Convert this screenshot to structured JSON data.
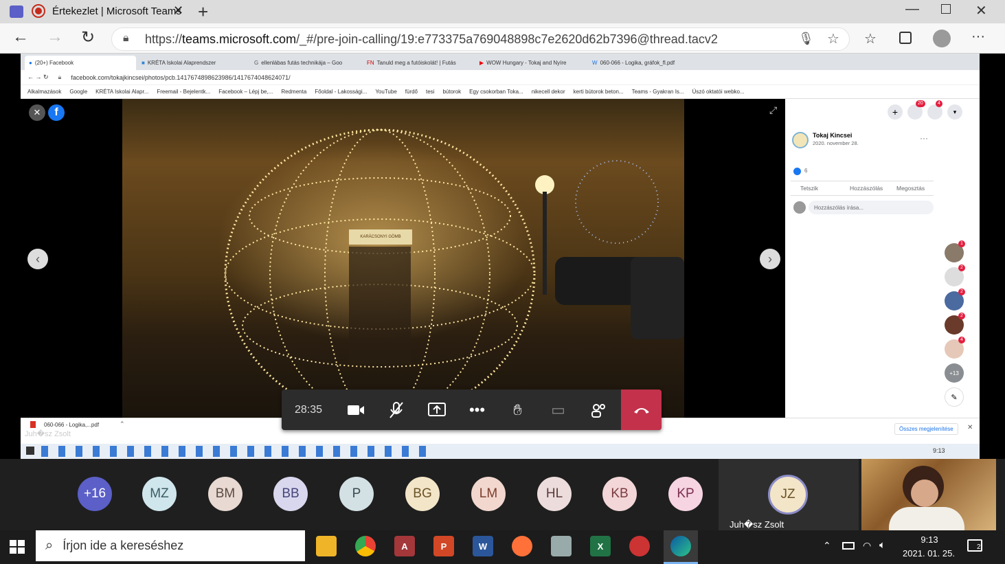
{
  "outer_tab": {
    "title": "Értekezlet | Microsoft Teams"
  },
  "outer_url": {
    "prefix": "https://",
    "host": "teams.microsoft.com",
    "path": "/_#/pre-join-calling/19:e773375a769048898c7e2620d62b7396@thread.tacv2"
  },
  "inner_tabs": [
    "(20+) Facebook",
    "KRÉTA Iskolai Alaprendszer",
    "ellenlábas futás technikája – Goo",
    "Tanuld meg a futóiskolát! | Futás",
    "WOW Hungary - Tokaj and Nyíre",
    "060-066 - Logika, gráfok_fl.pdf"
  ],
  "inner_url": "facebook.com/tokajkincsei/photos/pcb.1417674898623986/1417674048624071/",
  "bookmarks": [
    "Alkalmazások",
    "Google",
    "KRÉTA Iskolai Alapr...",
    "Freemail - Bejelentk...",
    "Facebook – Lépj be,...",
    "Redmenta",
    "Főoldal - Lakossági...",
    "YouTube",
    "fürdő",
    "tesi",
    "bútorok",
    "Egy csokorban Toka...",
    "nikecell dekor",
    "kerti bútorok beton...",
    "Teams - Gyakran Is...",
    "Úszó oktatói webko..."
  ],
  "photo_sign": "KARÁCSONYI GÖMB",
  "fb_post": {
    "page": "Tokaj Kincsei",
    "date": "2020. november 28.",
    "likes": "6",
    "like": "Tetszik",
    "comment": "Hozzászólás",
    "share": "Megosztás",
    "comment_placeholder": "Hozzászólás írása..."
  },
  "fb_badges": {
    "messenger": "20",
    "notifications": "4"
  },
  "fb_chat_badges": [
    "1",
    "2",
    "2",
    "2",
    "4"
  ],
  "fb_chat_more": "+13",
  "download": {
    "file": "060-066 - Logika,...pdf",
    "show_all": "Összes megjelenítése",
    "overlay_name": "Juh�sz Zsolt"
  },
  "inner_clock": "9:13",
  "call": {
    "timer": "28:35"
  },
  "participants": [
    {
      "label": "+16",
      "bg": "#5b5fc7",
      "fg": "#ffffff"
    },
    {
      "label": "MZ",
      "bg": "#cfe6ec",
      "fg": "#3b5a63"
    },
    {
      "label": "BM",
      "bg": "#e8d9d2",
      "fg": "#5a4a42"
    },
    {
      "label": "BB",
      "bg": "#d8d7ee",
      "fg": "#46457a"
    },
    {
      "label": "P",
      "bg": "#d3e0e4",
      "fg": "#3a4a50"
    },
    {
      "label": "BG",
      "bg": "#f3e5c8",
      "fg": "#6a5326"
    },
    {
      "label": "LM",
      "bg": "#f2d7cf",
      "fg": "#7a3d2c"
    },
    {
      "label": "HL",
      "bg": "#ecdcdc",
      "fg": "#5a3a3a"
    },
    {
      "label": "KB",
      "bg": "#f3d6d8",
      "fg": "#7a3a40"
    },
    {
      "label": "KP",
      "bg": "#f6d4e1",
      "fg": "#7a2e4e"
    }
  ],
  "speaker": {
    "initials": "JZ",
    "name": "Juh�sz Zsolt"
  },
  "taskbar": {
    "search_placeholder": "Írjon ide a kereséshez",
    "time": "9:13",
    "date": "2021. 01. 25.",
    "notif_count": "2"
  }
}
